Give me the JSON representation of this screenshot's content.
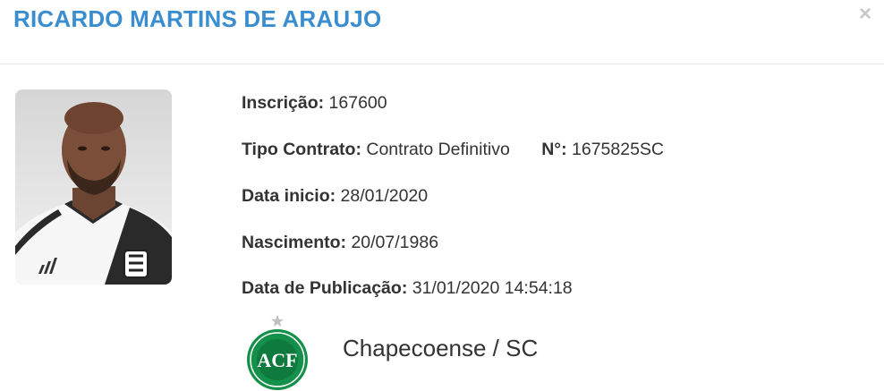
{
  "modal": {
    "title": "RICARDO MARTINS DE ARAUJO",
    "close_label": "×"
  },
  "athlete": {
    "photo_icon": "player-photo",
    "inscricao": {
      "label": "Inscrição:",
      "value": "167600"
    },
    "tipo_contrato": {
      "label": "Tipo Contrato:",
      "value": "Contrato Definitivo"
    },
    "numero": {
      "label": "N°:",
      "value": "1675825SC"
    },
    "data_inicio": {
      "label": "Data inicio:",
      "value": "28/01/2020"
    },
    "nascimento": {
      "label": "Nascimento:",
      "value": "20/07/1986"
    },
    "data_publicacao": {
      "label": "Data de Publicação:",
      "value": "31/01/2020 14:54:18"
    }
  },
  "club": {
    "name": "Chapecoense / SC",
    "logo_text": "ACF",
    "logo_icon": "club-crest-icon"
  },
  "colors": {
    "title": "#3a8ecf",
    "text": "#333333",
    "close": "#c8c8c8",
    "crest_green": "#14904a"
  }
}
